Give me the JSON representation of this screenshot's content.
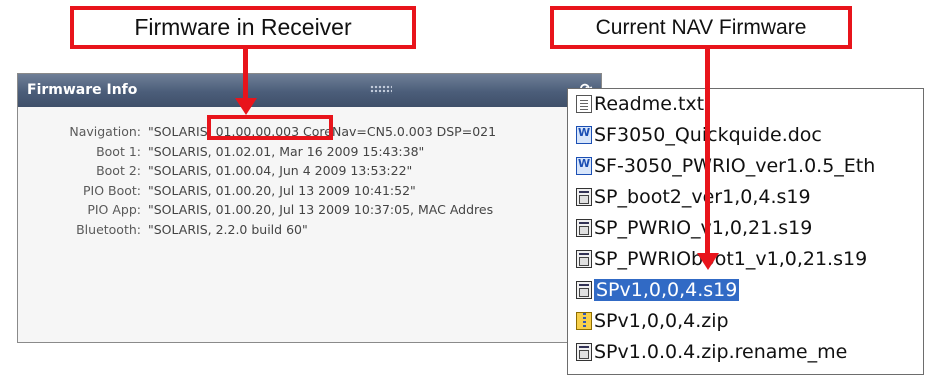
{
  "callouts": {
    "receiver": "Firmware in Receiver",
    "nav": "Current NAV Firmware"
  },
  "panel": {
    "title": "Firmware Info",
    "rows": [
      {
        "label": "Navigation:",
        "value": "\"SOLARIS, 01.00.00.003 CoreNav=CN5.0.003 DSP=021"
      },
      {
        "label": "Boot 1:",
        "value": "\"SOLARIS, 01.02.01, Mar 16 2009 15:43:38\""
      },
      {
        "label": "Boot 2:",
        "value": "\"SOLARIS, 01.00.04, Jun 4 2009 13:53:22\""
      },
      {
        "label": "PIO Boot:",
        "value": "\"SOLARIS, 01.00.20, Jul 13 2009 10:41:52\""
      },
      {
        "label": "PIO App:",
        "value": "\"SOLARIS, 01.00.20, Jul 13 2009 10:37:05, MAC Addres"
      },
      {
        "label": "Bluetooth:",
        "value": "\"SOLARIS, 2.2.0 build 60\""
      }
    ]
  },
  "files": [
    {
      "name": "Readme.txt",
      "icon": "text-file-icon",
      "type": "txt",
      "selected": false
    },
    {
      "name": "SF3050_Quickquide.doc",
      "icon": "word-document-icon",
      "type": "doc",
      "selected": false
    },
    {
      "name": "SF-3050_PWRIO_ver1.0.5_Eth",
      "icon": "word-document-icon",
      "type": "doc",
      "selected": false
    },
    {
      "name": "SP_boot2_ver1,0,4.s19",
      "icon": "s19-file-icon",
      "type": "s19",
      "selected": false
    },
    {
      "name": "SP_PWRIO_v1,0,21.s19",
      "icon": "s19-file-icon",
      "type": "s19",
      "selected": false
    },
    {
      "name": "SP_PWRIOboot1_v1,0,21.s19",
      "icon": "s19-file-icon",
      "type": "s19",
      "selected": false
    },
    {
      "name": "SPv1,0,0,4.s19",
      "icon": "s19-file-icon",
      "type": "s19",
      "selected": true
    },
    {
      "name": "SPv1,0,0,4.zip",
      "icon": "zip-file-icon",
      "type": "zip",
      "selected": false
    },
    {
      "name": "SPv1.0.0.4.zip.rename_me",
      "icon": "s19-file-icon",
      "type": "s19",
      "selected": false
    }
  ],
  "colors": {
    "accent_red": "#e8141b",
    "header_blue": "#4b5d79",
    "selection_blue": "#316ac5"
  }
}
